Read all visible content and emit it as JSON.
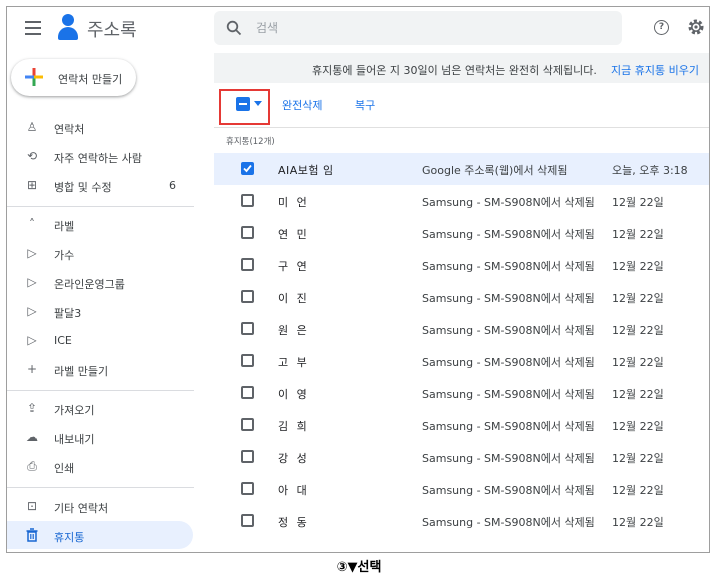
{
  "header": {
    "app_title": "주소록",
    "search_placeholder": "검색",
    "help_glyph": "?"
  },
  "sidebar": {
    "create_label": "연락처 만들기",
    "items": [
      {
        "label": "연락처",
        "icon": "person-icon",
        "glyph": "♙"
      },
      {
        "label": "자주 연락하는 사람",
        "icon": "history-icon",
        "glyph": "⟲"
      },
      {
        "label": "병합 및 수정",
        "icon": "merge-icon",
        "glyph": "⊞",
        "count": "6"
      },
      {
        "label": "라벨",
        "icon": "chevron-up-icon",
        "glyph": "˄"
      },
      {
        "label": "가수",
        "icon": "label-icon",
        "glyph": "▷"
      },
      {
        "label": "온라인운영그룹",
        "icon": "label-icon",
        "glyph": "▷"
      },
      {
        "label": "팔달3",
        "icon": "label-icon",
        "glyph": "▷"
      },
      {
        "label": "ICE",
        "icon": "label-icon",
        "glyph": "▷"
      },
      {
        "label": "라벨 만들기",
        "icon": "plus-icon",
        "glyph": "+"
      },
      {
        "label": "가져오기",
        "icon": "upload-icon",
        "glyph": "⇪"
      },
      {
        "label": "내보내기",
        "icon": "cloud-download-icon",
        "glyph": "☁"
      },
      {
        "label": "인쇄",
        "icon": "print-icon",
        "glyph": "⎙"
      },
      {
        "label": "기타 연락처",
        "icon": "archive-icon",
        "glyph": "⊡"
      },
      {
        "label": "휴지통",
        "icon": "trash-icon",
        "glyph": "🗑"
      }
    ]
  },
  "banner": {
    "text": "휴지통에 들어온 지 30일이 넘은 연락처는 완전히 삭제됩니다.",
    "link": "지금 휴지통 비우기"
  },
  "toolbar": {
    "delete_forever": "완전삭제",
    "restore": "복구"
  },
  "list": {
    "section_label": "휴지통(12개)",
    "rows": [
      {
        "name": "AIA보험 임",
        "source": "Google 주소록(웹)에서 삭제됨",
        "date": "오늘, 오후 3:18",
        "checked": true
      },
      {
        "name": "미  언",
        "source": "Samsung - SM-S908N에서 삭제됨",
        "date": "12월 22일",
        "checked": false
      },
      {
        "name": "연  민",
        "source": "Samsung - SM-S908N에서 삭제됨",
        "date": "12월 22일",
        "checked": false
      },
      {
        "name": "구  연",
        "source": "Samsung - SM-S908N에서 삭제됨",
        "date": "12월 22일",
        "checked": false
      },
      {
        "name": "이  진",
        "source": "Samsung - SM-S908N에서 삭제됨",
        "date": "12월 22일",
        "checked": false
      },
      {
        "name": "원  은",
        "source": "Samsung - SM-S908N에서 삭제됨",
        "date": "12월 22일",
        "checked": false
      },
      {
        "name": "고  부",
        "source": "Samsung - SM-S908N에서 삭제됨",
        "date": "12월 22일",
        "checked": false
      },
      {
        "name": "이  영",
        "source": "Samsung - SM-S908N에서 삭제됨",
        "date": "12월 22일",
        "checked": false
      },
      {
        "name": "김  희",
        "source": "Samsung - SM-S908N에서 삭제됨",
        "date": "12월 22일",
        "checked": false
      },
      {
        "name": "강  성",
        "source": "Samsung - SM-S908N에서 삭제됨",
        "date": "12월 22일",
        "checked": false
      },
      {
        "name": "아  대",
        "source": "Samsung - SM-S908N에서 삭제됨",
        "date": "12월 22일",
        "checked": false
      },
      {
        "name": "정  동",
        "source": "Samsung - SM-S908N에서 삭제됨",
        "date": "12월 22일",
        "checked": false
      }
    ]
  },
  "caption": "③▼선택",
  "colors": {
    "accent": "#1a73e8",
    "highlight_box": "#e53935",
    "selected_row": "#e8f0fe"
  }
}
